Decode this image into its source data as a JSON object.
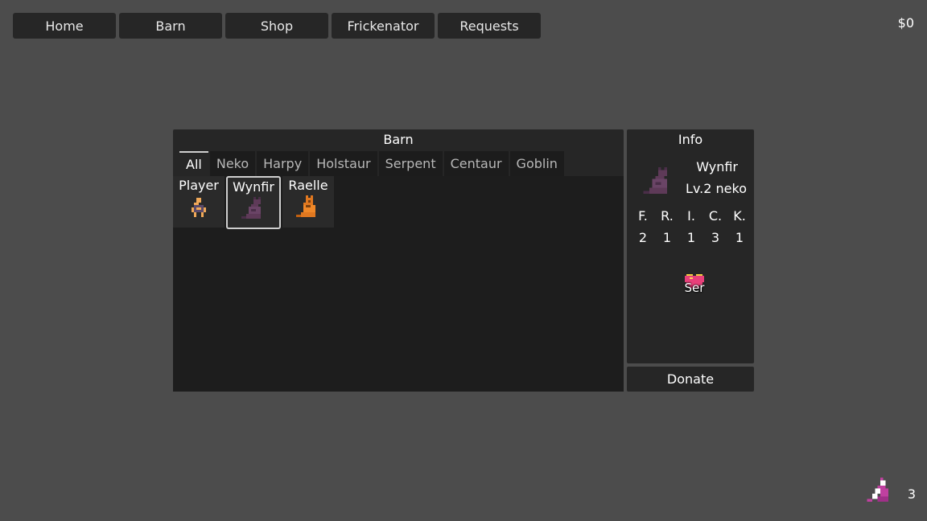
{
  "nav": {
    "items": [
      "Home",
      "Barn",
      "Shop",
      "Frickenator",
      "Requests"
    ]
  },
  "money": "$0",
  "barn": {
    "title": "Barn",
    "tabs": [
      "All",
      "Neko",
      "Harpy",
      "Holstaur",
      "Serpent",
      "Centaur",
      "Goblin"
    ],
    "active_tab": "All",
    "cards": [
      {
        "name": "Player",
        "sprite": "player-sprite-icon",
        "color": "#e8a050"
      },
      {
        "name": "Wynfir",
        "sprite": "neko-sprite-icon",
        "color": "#5e3a58",
        "selected": true
      },
      {
        "name": "Raelle",
        "sprite": "orange-sprite-icon",
        "color": "#e07820"
      }
    ]
  },
  "info": {
    "title": "Info",
    "name": "Wynfir",
    "level": "Lv.2 neko",
    "stats": [
      {
        "label": "F.",
        "value": "2"
      },
      {
        "label": "R.",
        "value": "1"
      },
      {
        "label": "I.",
        "value": "1"
      },
      {
        "label": "C.",
        "value": "3"
      },
      {
        "label": "K.",
        "value": "1"
      }
    ],
    "trait": {
      "label": "Ser",
      "icon": "crown-heart-icon",
      "color": "#e8407a"
    }
  },
  "donate_label": "Donate",
  "corner": {
    "count": "3",
    "icon": "pink-creature-icon",
    "color": "#c040a0"
  }
}
